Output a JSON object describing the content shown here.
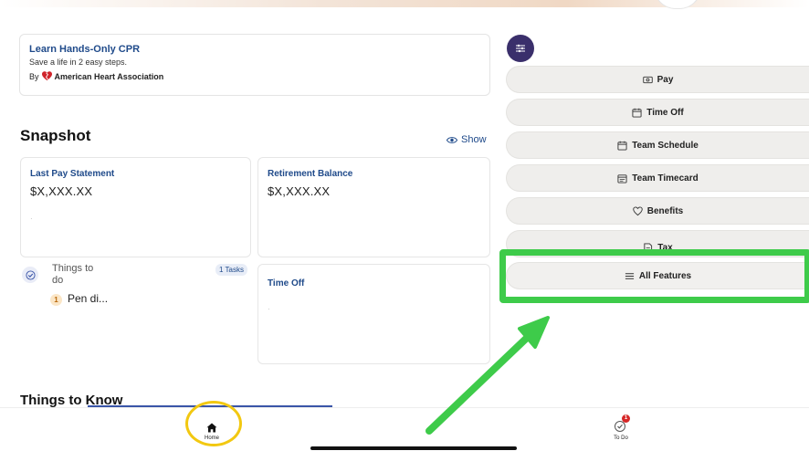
{
  "promo": {
    "title": "Learn Hands-Only CPR",
    "subtitle": "Save a life in 2 easy steps.",
    "by_label": "By",
    "sponsor": "American Heart Association"
  },
  "snapshot": {
    "title": "Snapshot",
    "show_label": "Show",
    "tiles": {
      "pay": {
        "label": "Last Pay Statement",
        "value": "$X,XXX.XX"
      },
      "retirement": {
        "label": "Retirement Balance",
        "value": "$X,XXX.XX"
      },
      "time_off": {
        "label": "Time Off"
      }
    },
    "todo": {
      "title": "Things to do",
      "badge": "1 Tasks",
      "item_number": "1",
      "item_text": "Pen di..."
    }
  },
  "things_to_know": {
    "title": "Things to Know"
  },
  "menu": {
    "items": [
      {
        "label": "Pay",
        "icon": "money-icon"
      },
      {
        "label": "Time Off",
        "icon": "calendar-icon"
      },
      {
        "label": "Team Schedule",
        "icon": "calendar-icon"
      },
      {
        "label": "Team Timecard",
        "icon": "timecard-icon"
      },
      {
        "label": "Benefits",
        "icon": "heart-icon"
      },
      {
        "label": "Tax",
        "icon": "document-icon"
      },
      {
        "label": "All Features",
        "icon": "list-icon"
      }
    ]
  },
  "bottom_nav": {
    "home_label": "Home",
    "todo_label": "To Do",
    "todo_count": "1"
  },
  "colors": {
    "accent_blue": "#1f4a8a",
    "toggle_purple": "#3a2f6b",
    "highlight_green": "#3ecb4a",
    "highlight_yellow": "#f2c811",
    "badge_red": "#d62828"
  }
}
